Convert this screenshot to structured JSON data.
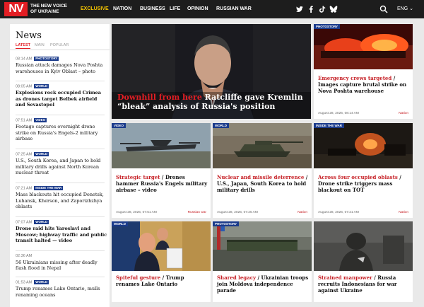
{
  "header": {
    "logo": "NV",
    "logo_sub": "THE NEW VOICE OF UKRAINE",
    "nav": [
      "EXCLUSIVE",
      "NATION",
      "BUSINESS",
      "LIFE",
      "OPINION",
      "RUSSIAN WAR"
    ],
    "lang": "ENG"
  },
  "news": {
    "title": "News",
    "tabs": [
      "LATEST",
      "MAIN",
      "POPULAR"
    ],
    "items": [
      {
        "time": "08:14 AM",
        "badge": "PHOTOSTORY",
        "title": "Russian attack damages Nova Poshta warehouses in Kyiv Oblast – photo",
        "bold": false
      },
      {
        "time": "08:05 AM",
        "badge": "WORLD",
        "title": "Explosions rock occupied Crimea as drones target Belbek airfield and Sevastopol",
        "bold": true
      },
      {
        "time": "07:51 AM",
        "badge": "VIDEO",
        "title": "Footage captures overnight drone strike on Russia's Engels-2 military airbase",
        "bold": false
      },
      {
        "time": "07:25 AM",
        "badge": "WORLD",
        "title": "U.S., South Korea, and Japan to hold military drills against North Korean nuclear threat",
        "bold": false
      },
      {
        "time": "07:21 AM",
        "badge": "INSIDE THE WAR",
        "title": "Mass blackouts hit occupied Donetsk, Luhansk, Kherson, and Zaporizhzhya oblasts",
        "bold": false
      },
      {
        "time": "07:07 AM",
        "badge": "WORLD",
        "title": "Drone raid hits Yaroslavl and Moscow; highway traffic and public transit halted — video",
        "bold": true
      },
      {
        "time": "02:36 AM",
        "badge": "",
        "title": "56 Ukrainians missing after deadly flash flood in Nepal",
        "bold": false
      },
      {
        "time": "01:53 AM",
        "badge": "WORLD",
        "title": "Trump renames Lake Ontario, mulls renaming oceans",
        "bold": false
      }
    ]
  },
  "hero": {
    "highlight": "Downhill from here",
    "rest": " Ratcliffe gave Kremlin “bleak” analysis of Russia's position"
  },
  "cards": [
    {
      "badge": "PHOTOSTORY",
      "hl": "Emergency crews targeted",
      "rest": "Images capture brutal strike on Nova Poshta warehouse",
      "date": "August 28, 2026, 08:14 AM",
      "cat": "Nation"
    },
    {
      "badge": "VIDEO",
      "hl": "Strategic target",
      "rest": "Drones hammer Russia's Engels military airbase – video",
      "date": "August 28, 2026, 07:51 AM",
      "cat": "Russian war"
    },
    {
      "badge": "WORLD",
      "hl": "Nuclear and missile deterrence",
      "rest": "U.S., Japan, South Korea to hold military drills",
      "date": "August 28, 2026, 07:25 AM",
      "cat": "Nation"
    },
    {
      "badge": "INSIDE THE WAR",
      "hl": "Across four occupied oblasts",
      "rest": "Drone strike triggers mass blackout on TOT",
      "date": "August 28, 2026, 07:21 AM",
      "cat": "Nation"
    },
    {
      "badge": "WORLD",
      "hl": "Spiteful gesture",
      "rest": "Trump renames Lake Ontario",
      "date": "",
      "cat": ""
    },
    {
      "badge": "PHOTOSTORY",
      "hl": "Shared legacy",
      "rest": "Ukrainian troops join Moldova independence parade",
      "date": "",
      "cat": ""
    },
    {
      "badge": "",
      "hl": "Strained manpower",
      "rest": "Russia recruits Indonesians for war against Ukraine",
      "date": "",
      "cat": ""
    }
  ]
}
